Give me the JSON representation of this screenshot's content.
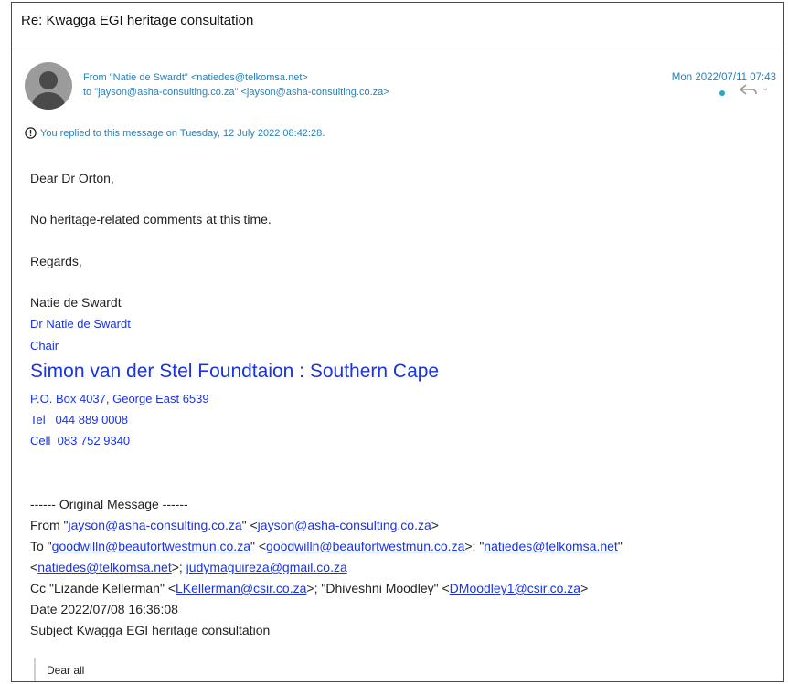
{
  "message": {
    "subject": "Re: Kwagga EGI heritage consultation",
    "from_line": "From \"Natie de Swardt\" <natiedes@telkomsa.net>",
    "to_line": "to \"jayson@asha-consulting.co.za\" <jayson@asha-consulting.co.za>",
    "date": "Mon 2022/07/11 07:43",
    "replied_notice": "You replied to this message on Tuesday, 12 July 2022 08:42:28."
  },
  "body": {
    "greeting": "Dear Dr Orton,",
    "content": "No heritage-related comments at this time.",
    "closing": "Regards,",
    "name": "Natie de Swardt"
  },
  "signature": {
    "name": "Dr Natie de Swardt",
    "title": "Chair",
    "organisation": "Simon van der Stel Foundtaion : Southern Cape",
    "address": "P.O. Box 4037, George East 6539",
    "tel_label": "Tel",
    "tel": "044 889 0008",
    "cell_label": "Cell",
    "cell": "083 752 9340"
  },
  "original": {
    "separator": "------ Original Message ------",
    "from_label": "From",
    "from_name": "jayson@asha-consulting.co.za",
    "from_addr": "jayson@asha-consulting.co.za",
    "to_label": "To",
    "to_1_name": "goodwilln@beaufortwestmun.co.za",
    "to_1_addr": "goodwilln@beaufortwestmun.co.za",
    "to_2_name": "natiedes@telkomsa.net",
    "to_2_addr": "natiedes@telkomsa.net",
    "to_3": "judymaguireza@gmail.co.za",
    "cc_label": "Cc",
    "cc_1_name": "Lizande Kellerman",
    "cc_1_addr": "LKellerman@csir.co.za",
    "cc_2_name": "Dhiveshni Moodley",
    "cc_2_addr": "DMoodley1@csir.co.za",
    "date_line": "Date 2022/07/08 16:36:08",
    "subject_line": "Subject Kwagga EGI heritage consultation",
    "quoted_greeting": "Dear all"
  },
  "icons": {
    "avatar": "person-avatar-icon",
    "info": "info-circle-icon",
    "reply": "reply-icon",
    "more": "chevron-down-icon",
    "unread": "dot-icon"
  },
  "colors": {
    "header_blue": "#2a7fb8",
    "signature_blue": "#1a33e6",
    "avatar_grey": "#9b9b9b"
  }
}
